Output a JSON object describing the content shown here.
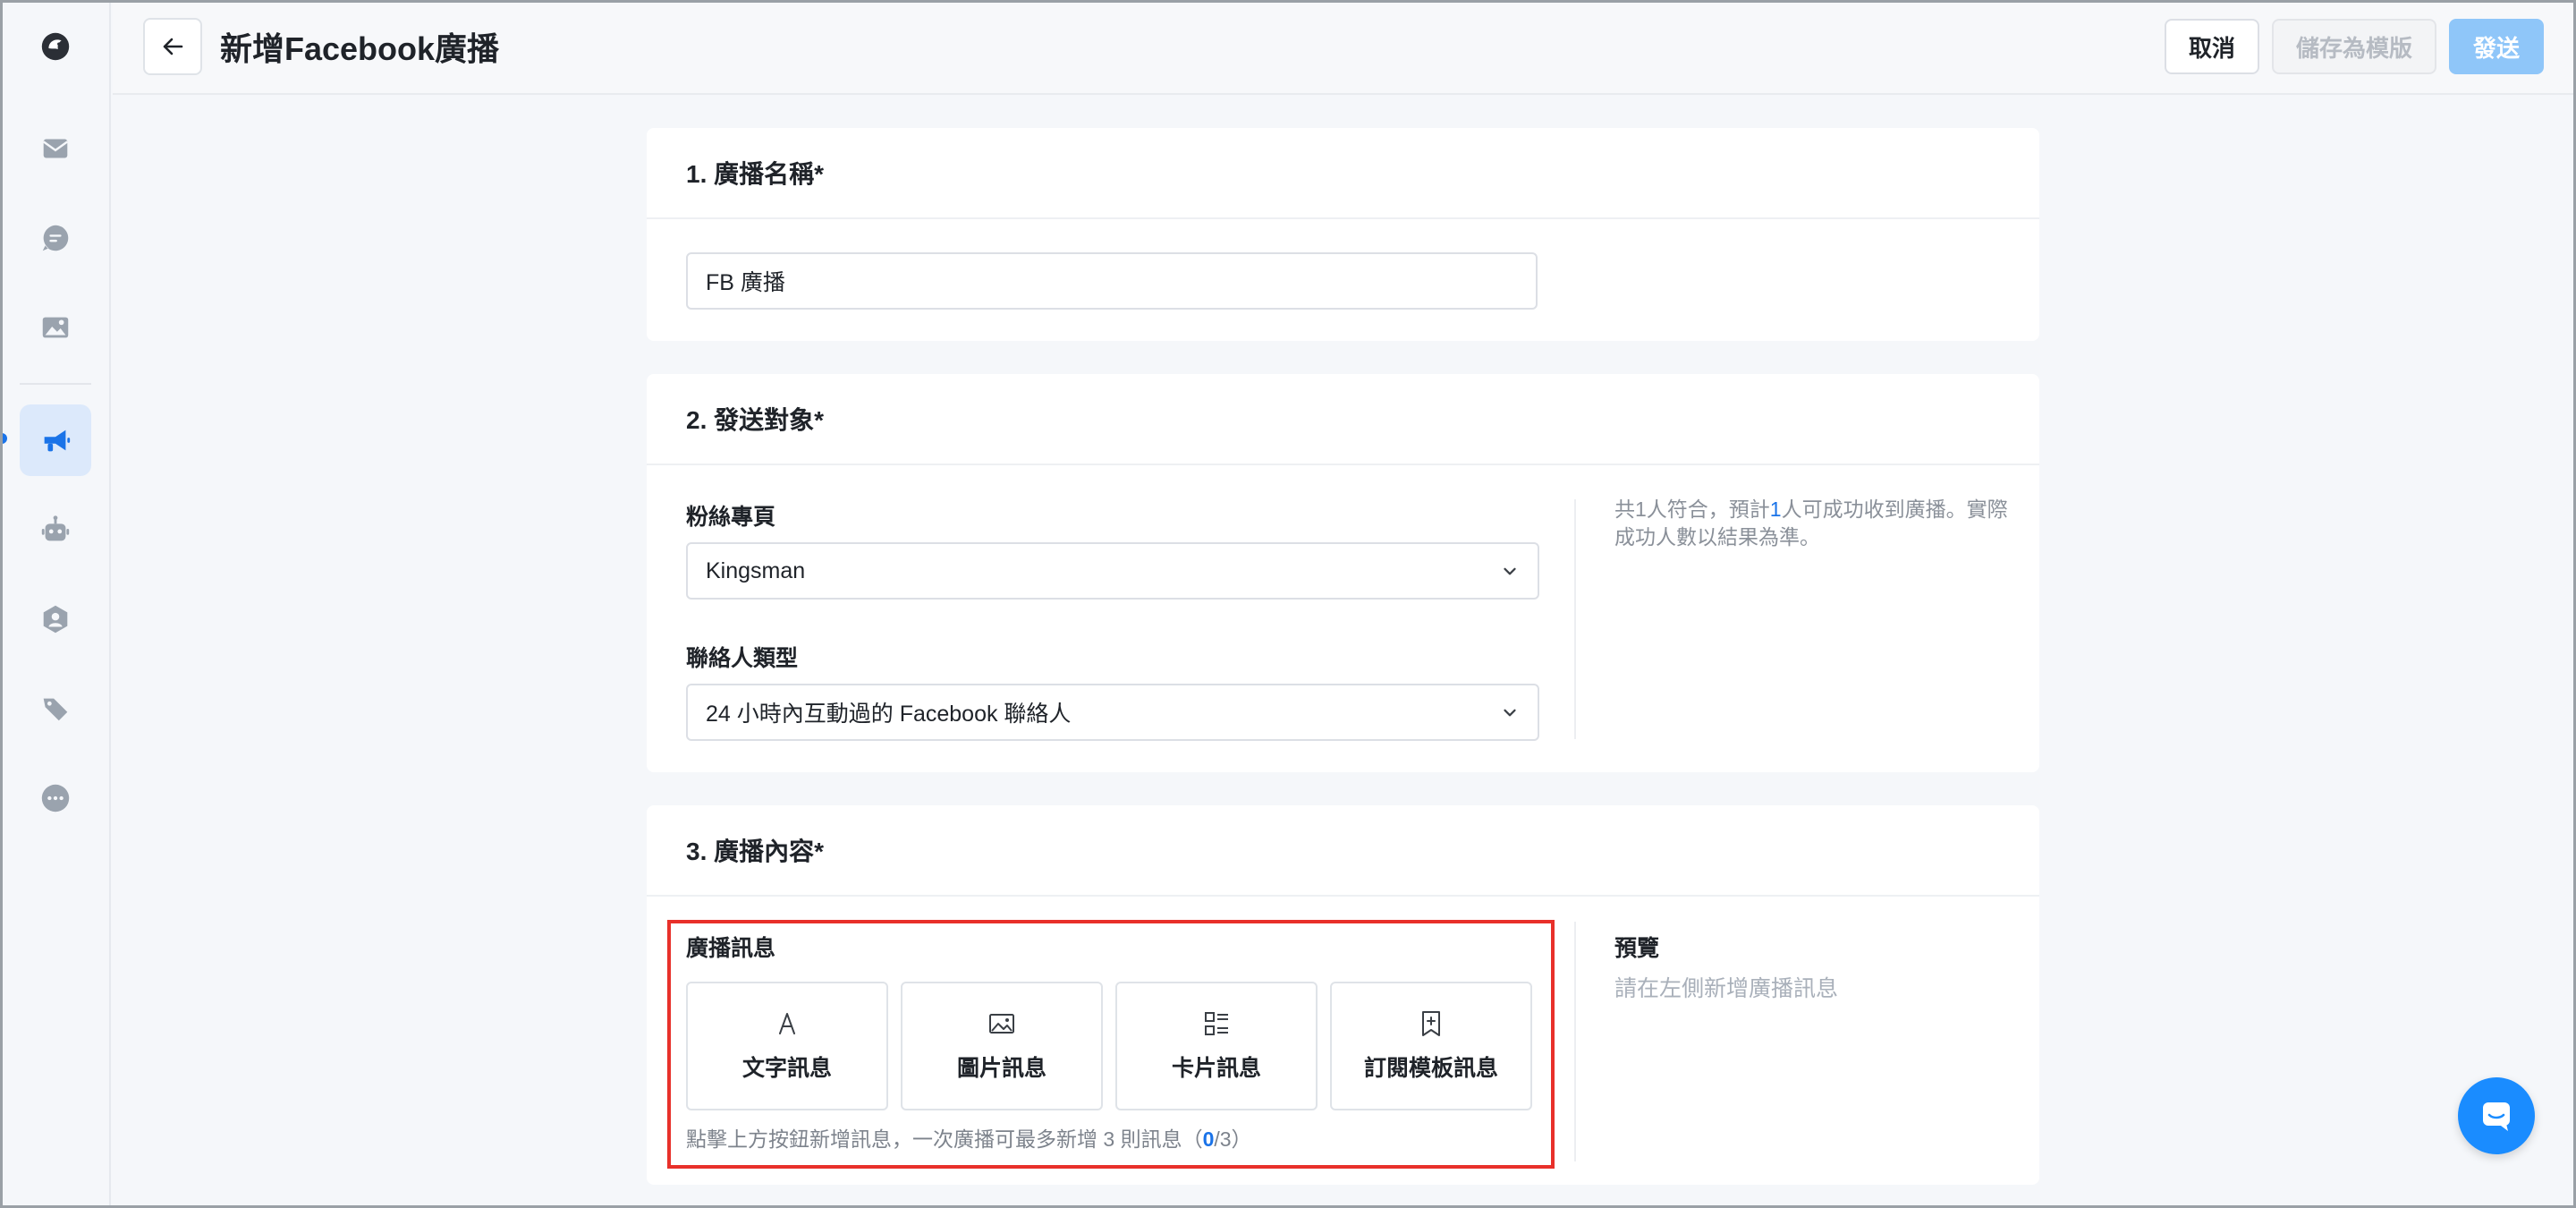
{
  "header": {
    "title": "新增Facebook廣播",
    "cancel_label": "取消",
    "save_template_label": "儲存為模版",
    "send_label": "發送"
  },
  "sidebar": {
    "items": [
      {
        "icon": "logo-icon"
      },
      {
        "icon": "inbox-icon"
      },
      {
        "icon": "chat-icon"
      },
      {
        "icon": "image-icon"
      },
      {
        "icon": "megaphone-icon",
        "active": true
      },
      {
        "icon": "bot-icon"
      },
      {
        "icon": "contact-icon"
      },
      {
        "icon": "tag-icon"
      },
      {
        "icon": "more-icon"
      }
    ]
  },
  "section1": {
    "title": "1. 廣播名稱*",
    "name_value": "FB 廣播"
  },
  "section2": {
    "title": "2. 發送對象*",
    "page_label": "粉絲專頁",
    "page_value": "Kingsman",
    "contact_type_label": "聯絡人類型",
    "contact_type_value": "24 小時內互動過的 Facebook 聯絡人",
    "hint_prefix": "共1人符合，預計",
    "hint_number": "1",
    "hint_suffix": "人可成功收到廣播。實際成功人數以結果為準。"
  },
  "section3": {
    "title": "3. 廣播內容*",
    "messages_label": "廣播訊息",
    "buttons": [
      {
        "label": "文字訊息",
        "icon": "text-icon"
      },
      {
        "label": "圖片訊息",
        "icon": "image-icon"
      },
      {
        "label": "卡片訊息",
        "icon": "card-list-icon"
      },
      {
        "label": "訂閱模板訊息",
        "icon": "bookmark-add-icon"
      }
    ],
    "note_prefix": "點擊上方按鈕新增訊息，一次廣播可最多新增 3 則訊息（",
    "note_current": "0",
    "note_suffix": "/3）",
    "preview_label": "預覽",
    "preview_placeholder": "請在左側新增廣播訊息"
  }
}
